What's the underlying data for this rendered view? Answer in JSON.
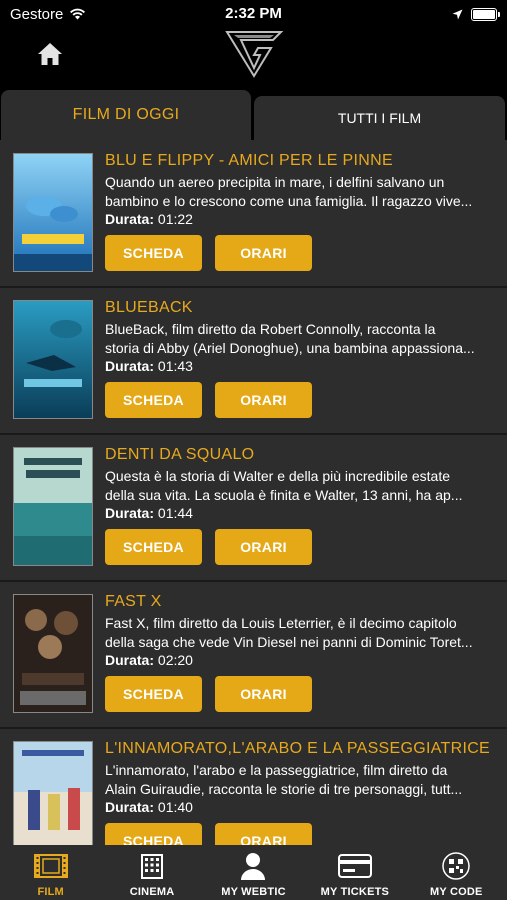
{
  "status_bar": {
    "carrier": "Gestore",
    "time": "2:32 PM"
  },
  "tabs": {
    "active": "FILM DI OGGI",
    "inactive": "TUTTI I FILM"
  },
  "films": [
    {
      "title": "BLU E FLIPPY - AMICI PER LE PINNE",
      "desc_line1": "Quando un aereo precipita in mare, i delfini salvano un",
      "desc_line2": "bambino e lo crescono come una famiglia. Il ragazzo vive...",
      "durata_label": "Durata:",
      "durata": "01:22",
      "scheda": "SCHEDA",
      "orari": "ORARI",
      "poster_colors": [
        "#2c8fd6",
        "#8fd3f5"
      ]
    },
    {
      "title": "BLUEBACK",
      "desc_line1": "BlueBack, film diretto da Robert Connolly, racconta la",
      "desc_line2": "storia di Abby (Ariel Donoghue), una bambina appassiona...",
      "durata_label": "Durata:",
      "durata": "01:43",
      "scheda": "SCHEDA",
      "orari": "ORARI",
      "poster_colors": [
        "#0f5a78",
        "#2a9cc2"
      ]
    },
    {
      "title": "DENTI DA SQUALO",
      "desc_line1": "Questa è la storia di Walter e della più incredibile estate",
      "desc_line2": "della sua vita. La scuola è finita e Walter, 13 anni, ha ap...",
      "durata_label": "Durata:",
      "durata": "01:44",
      "scheda": "SCHEDA",
      "orari": "ORARI",
      "poster_colors": [
        "#9fc9c0",
        "#2f8a8e"
      ]
    },
    {
      "title": "FAST X",
      "desc_line1": "Fast X, film diretto da Louis Leterrier, è il decimo capitolo",
      "desc_line2": "della saga che vede Vin Diesel nei panni di Dominic Toret...",
      "durata_label": "Durata:",
      "durata": "02:20",
      "scheda": "SCHEDA",
      "orari": "ORARI",
      "poster_colors": [
        "#3a2a22",
        "#8a6a4a"
      ]
    },
    {
      "title": "L'INNAMORATO,L'ARABO E LA PASSEGGIATRICE",
      "desc_line1": "L'innamorato, l'arabo e la passeggiatrice, film diretto da",
      "desc_line2": "Alain Guiraudie, racconta le storie di tre personaggi, tutt...",
      "durata_label": "Durata:",
      "durata": "01:40",
      "scheda": "SCHEDA",
      "orari": "ORARI",
      "poster_colors": [
        "#b8d6ea",
        "#e9dfcf"
      ]
    }
  ],
  "tabbar": [
    {
      "label": "FILM",
      "icon": "film-icon"
    },
    {
      "label": "CINEMA",
      "icon": "building-icon"
    },
    {
      "label": "MY WEBTIC",
      "icon": "user-icon"
    },
    {
      "label": "MY TICKETS",
      "icon": "card-icon"
    },
    {
      "label": "MY CODE",
      "icon": "qrcode-icon"
    }
  ],
  "colors": {
    "accent": "#e7a91d",
    "panel": "#2d2d2d",
    "background": "#000000"
  }
}
